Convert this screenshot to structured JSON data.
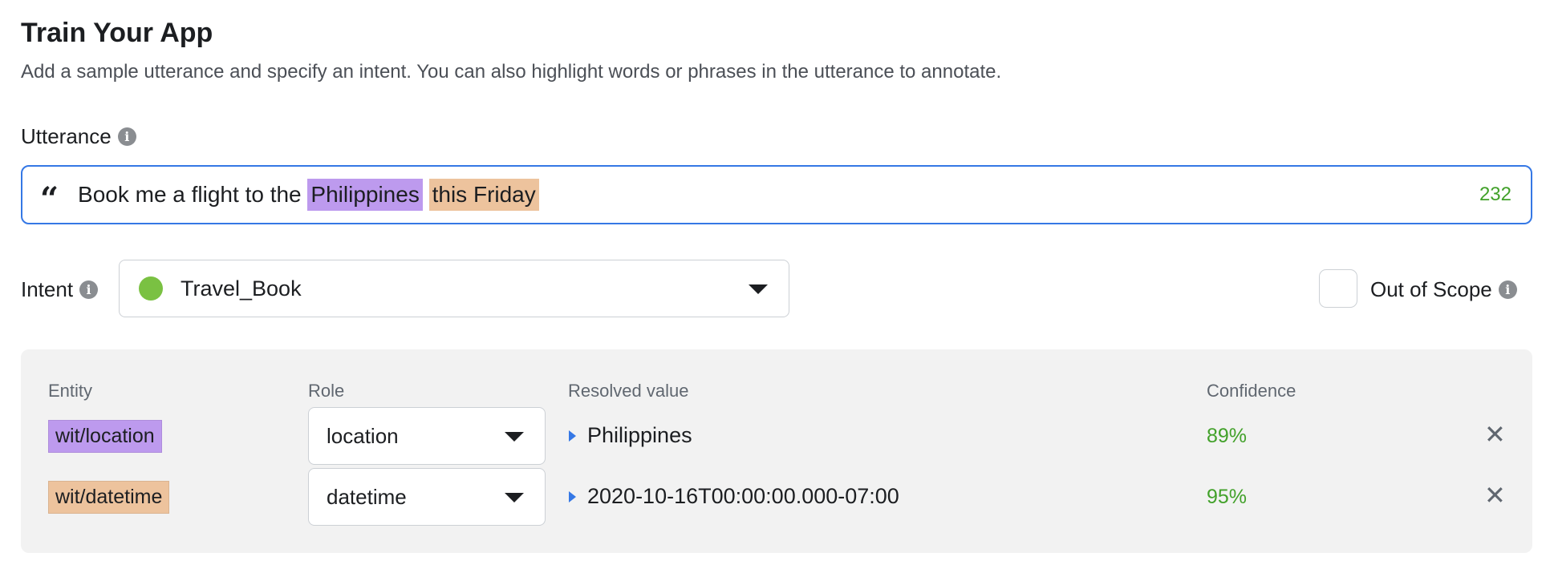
{
  "header": {
    "title": "Train Your App",
    "subtitle": "Add a sample utterance and specify an intent. You can also highlight words or phrases in the utterance to annotate."
  },
  "utterance": {
    "label": "Utterance",
    "quote_icon": "quote-icon",
    "segments": {
      "before": "Book me a flight to the ",
      "entity1": "Philippines",
      "between": " ",
      "entity2": "this Friday"
    },
    "char_count": "232"
  },
  "intent": {
    "label": "Intent",
    "selected": "Travel_Book",
    "dot_color": "#7ac142"
  },
  "out_of_scope": {
    "label": "Out of Scope",
    "checked": false
  },
  "entities": {
    "headers": {
      "entity": "Entity",
      "role": "Role",
      "resolved": "Resolved value",
      "confidence": "Confidence"
    },
    "rows": [
      {
        "entity": "wit/location",
        "role": "location",
        "resolved": "Philippines",
        "confidence": "89%",
        "highlight_color": "#bd9aee"
      },
      {
        "entity": "wit/datetime",
        "role": "datetime",
        "resolved": "2020-10-16T00:00:00.000-07:00",
        "confidence": "95%",
        "highlight_color": "#edc39d"
      }
    ]
  },
  "colors": {
    "focus_border": "#3578e5",
    "success_green": "#42a12a",
    "panel_bg": "#f2f2f2"
  }
}
